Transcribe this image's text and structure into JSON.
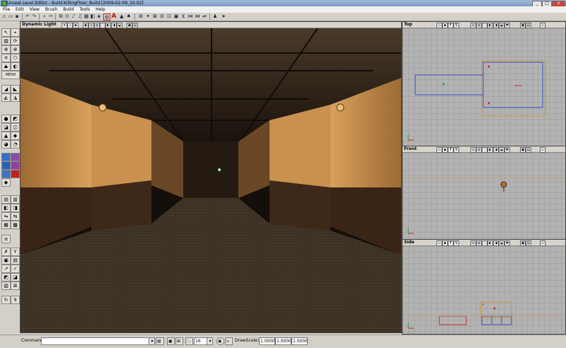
{
  "window": {
    "title": "Unreal Level Editor - Build KillingFloor_Build [2009-02-09_10.02]"
  },
  "menu": [
    "File",
    "Edit",
    "View",
    "Brush",
    "Build",
    "Tools",
    "Help"
  ],
  "toolbar_icons": [
    "new-icon",
    "open-icon",
    "save-icon",
    "undo-icon",
    "redo-icon",
    "search-icon",
    "cut-icon",
    "copy-icon",
    "paste-icon",
    "actor-browser-icon",
    "group-browser-icon",
    "music-icon",
    "sound-icon",
    "texture-browser-icon",
    "mesh-browser-icon",
    "prefab-browser-icon",
    "static-mesh-icon",
    "animation-icon",
    "text-A-icon",
    "shader-icon",
    "build-geometry-icon",
    "build-lighting-icon",
    "build-paths-icon",
    "build-all-icon",
    "play-icon",
    "cursor-icon"
  ],
  "viewports": {
    "perspective": {
      "label": "Dynamic Light"
    },
    "top": {
      "label": "Top"
    },
    "front": {
      "label": "Front"
    },
    "side": {
      "label": "Side"
    }
  },
  "statusbar": {
    "command_label": "Command",
    "command_value": "",
    "grid_value": "16",
    "drawscale_label": "DrawScale3D",
    "drawscale_x": "1.0000",
    "drawscale_y": "1.0000",
    "drawscale_z": "1.0000"
  },
  "colors": {
    "title_bg": "#8aa8cf",
    "viewport_bg": "#b3b3b3",
    "brush_blue": "#3b4fc4",
    "brush_orange": "#c8963c",
    "brush_red": "#c03030"
  }
}
